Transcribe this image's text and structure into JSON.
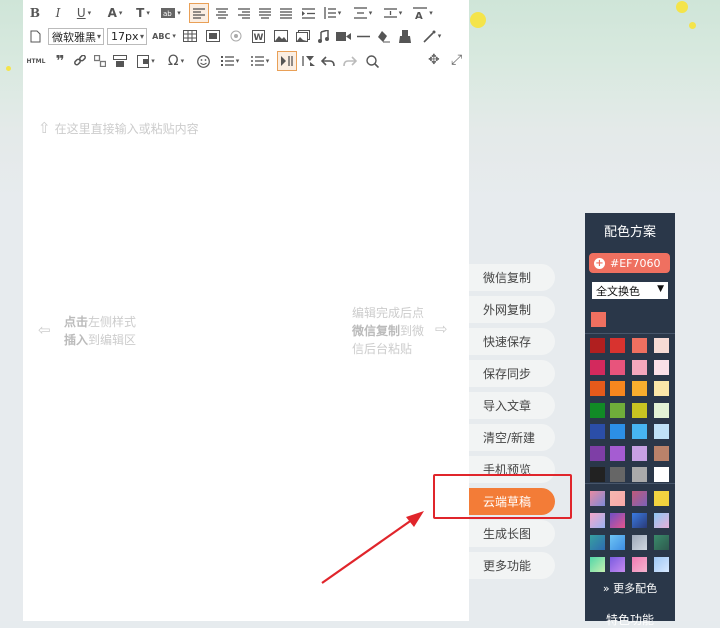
{
  "toolbar": {
    "font_family": "微软雅黑",
    "font_size": "17px",
    "html_label": "HTML",
    "abc_label": "ABC"
  },
  "editor": {
    "placeholder_hint": "在这里直接输入或粘贴内容",
    "left_hint_bold1": "点击",
    "left_hint_text1": "左侧样式",
    "left_hint_bold2": "插入",
    "left_hint_text2": "到编辑区",
    "right_hint_line1": "编辑完成后点",
    "right_hint_bold": "微信复制",
    "right_hint_line2b": "到微",
    "right_hint_line3": "信后台粘贴"
  },
  "side_menu": {
    "items": [
      "微信复制",
      "外网复制",
      "快速保存",
      "保存同步",
      "导入文章",
      "清空/新建",
      "手机预览",
      "云端草稿",
      "生成长图",
      "更多功能"
    ],
    "highlighted": "云端草稿"
  },
  "color_panel": {
    "title": "配色方案",
    "current_color": "#EF7060",
    "scope_select": "全文换色",
    "more_colors": "更多配色",
    "features_title": "特色功能",
    "swatch_rows": [
      [
        "#b01f1f",
        "#d8332f",
        "#ef7060",
        "#f6dbd5"
      ],
      [
        "#d3295d",
        "#e8547c",
        "#f4a7bd",
        "#fae0e7"
      ],
      [
        "#e55a1b",
        "#f7871e",
        "#f8ae2e",
        "#fbe7a8"
      ],
      [
        "#118a26",
        "#6fad3a",
        "#c8c421",
        "#e3f2d5"
      ],
      [
        "#2b4ea8",
        "#2c8fe6",
        "#47b4f1",
        "#bfe1f7"
      ],
      [
        "#7e3ea6",
        "#a55cd2",
        "#c7a1e4",
        "#b9826a"
      ],
      [
        "#222222",
        "#666666",
        "#aaaaaa",
        "#ffffff"
      ]
    ],
    "gradient_rows": [
      [
        [
          "#e88ba3",
          "#7c8ad8"
        ],
        [
          "#f6b7b0",
          "#f8a8a8"
        ],
        [
          "#c05a7a",
          "#7c62b8"
        ],
        [
          "#f2d543",
          "#f0d03c"
        ]
      ],
      [
        [
          "#f4a7c9",
          "#9ab3f2"
        ],
        [
          "#6f4fc4",
          "#e5558d"
        ],
        [
          "#3a7be0",
          "#2a3a78"
        ],
        [
          "#8ec7f4",
          "#e6b0d8"
        ]
      ],
      [
        [
          "#37a0a0",
          "#2e6bb0"
        ],
        [
          "#6ec5f5",
          "#3d8de3"
        ],
        [
          "#9da8b8",
          "#d0d8e2"
        ],
        [
          "#3a8a6a",
          "#2e5a4e"
        ]
      ],
      [
        [
          "#52d6a8",
          "#c6f0b0"
        ],
        [
          "#7a5ce0",
          "#c78bf0"
        ],
        [
          "#f07ab2",
          "#f4b5d0"
        ],
        [
          "#9ec8f4",
          "#d8e8ff"
        ]
      ]
    ]
  }
}
